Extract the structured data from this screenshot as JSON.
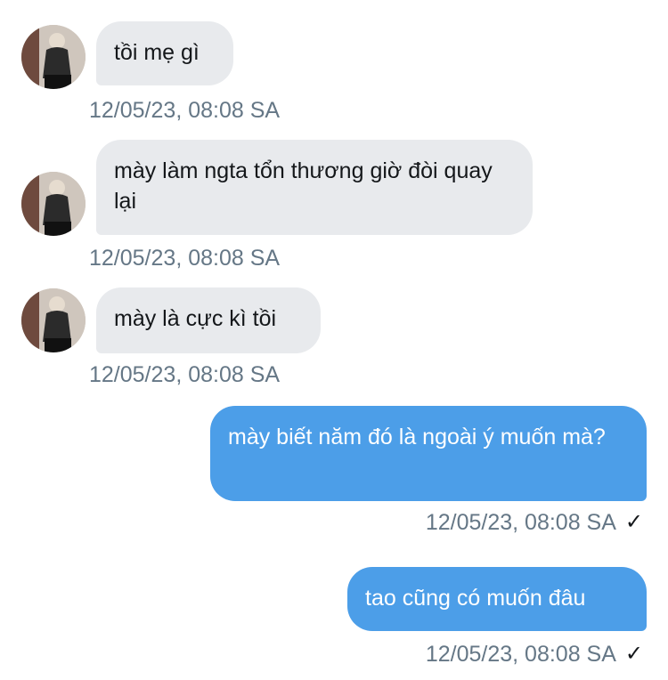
{
  "messages": [
    {
      "sender": "other",
      "text": "tồi mẹ gì",
      "time": "12/05/23, 08:08 SA"
    },
    {
      "sender": "other",
      "text": "mày làm ngta tổn thương giờ đòi quay lại",
      "time": "12/05/23, 08:08 SA"
    },
    {
      "sender": "other",
      "text": "mày là cực kì tồi",
      "time": "12/05/23, 08:08 SA"
    },
    {
      "sender": "me",
      "text": "mày biết năm đó là ngoài ý muốn mà?",
      "time": "12/05/23, 08:08 SA",
      "status_icon": "check-icon"
    },
    {
      "sender": "me",
      "text": "tao cũng có muốn đâu",
      "time": "12/05/23, 08:08 SA",
      "status_icon": "check-icon"
    }
  ],
  "colors": {
    "incoming_bubble": "#e8eaed",
    "outgoing_bubble": "#4c9ee8",
    "timestamp": "#657786"
  }
}
